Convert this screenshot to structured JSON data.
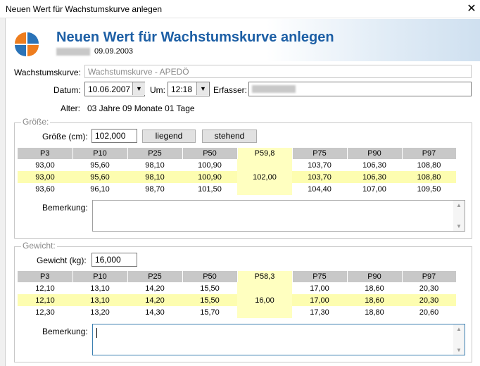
{
  "window": {
    "title": "Neuen Wert für Wachstumskurve anlegen",
    "close_glyph": "✕"
  },
  "header": {
    "title": "Neuen Wert für Wachstumskurve anlegen",
    "patient_date": "09.09.2003"
  },
  "form": {
    "kurve_label": "Wachstumskurve:",
    "kurve_value": "Wachstumskurve - APEDÖ",
    "datum_label": "Datum:",
    "datum_value": "10.06.2007",
    "um_label": "Um:",
    "um_value": "12:18",
    "erfasser_label": "Erfasser:",
    "alter_label": "Alter:",
    "alter_value": "03 Jahre 09 Monate 01 Tage"
  },
  "groesse": {
    "group_title": "Größe:",
    "input_label": "Größe (cm):",
    "input_value": "102,000",
    "btn_liegend": "liegend",
    "btn_stehend": "stehend",
    "headers": [
      "P3",
      "P10",
      "P25",
      "P50",
      "P59,8",
      "P75",
      "P90",
      "P97"
    ],
    "rows": [
      [
        "93,00",
        "95,60",
        "98,10",
        "100,90",
        "",
        "103,70",
        "106,30",
        "108,80"
      ],
      [
        "93,00",
        "95,60",
        "98,10",
        "100,90",
        "102,00",
        "103,70",
        "106,30",
        "108,80"
      ],
      [
        "93,60",
        "96,10",
        "98,70",
        "101,50",
        "",
        "104,40",
        "107,00",
        "109,50"
      ]
    ],
    "bemerkung_label": "Bemerkung:"
  },
  "gewicht": {
    "group_title": "Gewicht:",
    "input_label": "Gewicht (kg):",
    "input_value": "16,000",
    "headers": [
      "P3",
      "P10",
      "P25",
      "P50",
      "P58,3",
      "P75",
      "P90",
      "P97"
    ],
    "rows": [
      [
        "12,10",
        "13,10",
        "14,20",
        "15,50",
        "",
        "17,00",
        "18,60",
        "20,30"
      ],
      [
        "12,10",
        "13,10",
        "14,20",
        "15,50",
        "16,00",
        "17,00",
        "18,60",
        "20,30"
      ],
      [
        "12,30",
        "13,20",
        "14,30",
        "15,70",
        "",
        "17,30",
        "18,80",
        "20,60"
      ]
    ],
    "bemerkung_label": "Bemerkung:"
  },
  "colors": {
    "accent": "#1d5fa5",
    "highlight_row": "#fdfdb0",
    "highlight_col": "#ffffc0",
    "header_cell": "#c8c8c8"
  }
}
